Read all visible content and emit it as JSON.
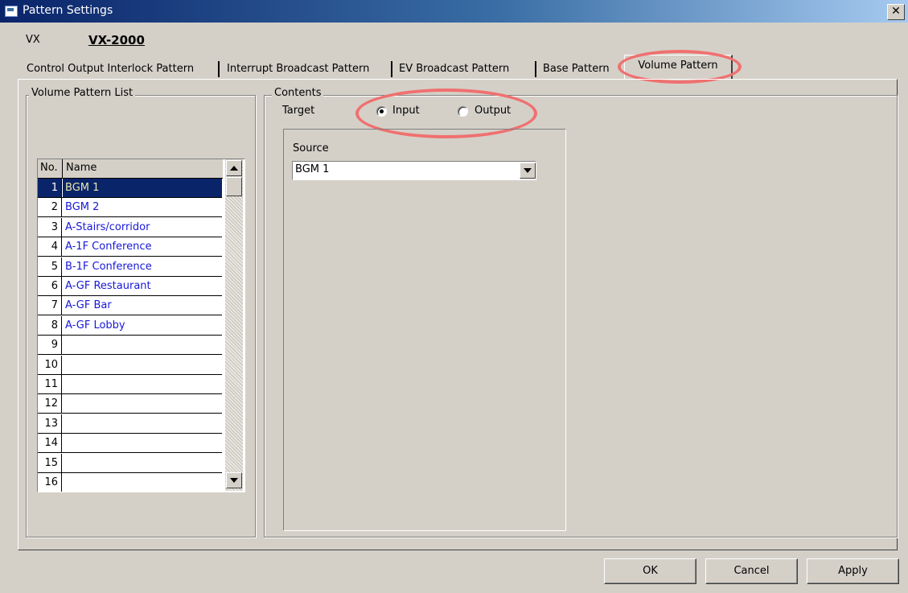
{
  "window": {
    "title": "Pattern Settings",
    "close": "✕"
  },
  "device": {
    "label": "VX",
    "model": "VX-2000"
  },
  "tabs": [
    "Control Output Interlock Pattern",
    "Interrupt Broadcast Pattern",
    "EV Broadcast Pattern",
    "Base Pattern",
    "Volume Pattern"
  ],
  "active_tab": "Volume Pattern",
  "list_group": {
    "title": "Volume Pattern List",
    "headers": {
      "no": "No.",
      "name": "Name"
    },
    "rows": [
      {
        "no": "1",
        "name": "BGM 1"
      },
      {
        "no": "2",
        "name": "BGM 2"
      },
      {
        "no": "3",
        "name": "A-Stairs/corridor"
      },
      {
        "no": "4",
        "name": "A-1F Conference"
      },
      {
        "no": "5",
        "name": "B-1F Conference"
      },
      {
        "no": "6",
        "name": "A-GF Restaurant"
      },
      {
        "no": "7",
        "name": "A-GF Bar"
      },
      {
        "no": "8",
        "name": "A-GF Lobby"
      },
      {
        "no": "9",
        "name": ""
      },
      {
        "no": "10",
        "name": ""
      },
      {
        "no": "11",
        "name": ""
      },
      {
        "no": "12",
        "name": ""
      },
      {
        "no": "13",
        "name": ""
      },
      {
        "no": "14",
        "name": ""
      },
      {
        "no": "15",
        "name": ""
      },
      {
        "no": "16",
        "name": ""
      }
    ],
    "selected_index": 0
  },
  "contents_group": {
    "title": "Contents",
    "target_label": "Target",
    "radio_input": "Input",
    "radio_output": "Output",
    "selected_target": "Input",
    "source_label": "Source",
    "source_value": "BGM 1"
  },
  "buttons": {
    "ok": "OK",
    "cancel": "Cancel",
    "apply": "Apply"
  },
  "colors": {
    "highlight": "#f07070",
    "selection": "#0a246a",
    "name_text": "#1818d8"
  }
}
